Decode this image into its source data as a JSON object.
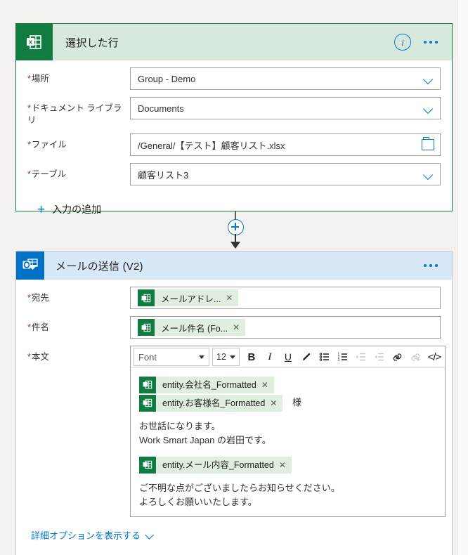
{
  "page": {
    "background": "#f3f2f1",
    "accent": "#0078d4"
  },
  "excel_card": {
    "title": "選択した行",
    "icon": "excel-icon",
    "accent": "#107c41",
    "header_background": "#d7e9dd",
    "info_label": "i",
    "more_label": "…",
    "fields": [
      {
        "label": "場所",
        "required": "*",
        "value": "Group - Demo",
        "control": "dropdown"
      },
      {
        "label": "ドキュメント ライブラリ",
        "required": "*",
        "value": "Documents",
        "control": "dropdown"
      },
      {
        "label": "ファイル",
        "required": "*",
        "value": "/General/【テスト】顧客リスト.xlsx",
        "control": "folder"
      },
      {
        "label": "テーブル",
        "required": "*",
        "value": "顧客リスト3",
        "control": "dropdown"
      }
    ],
    "add_input_label": "入力の追加",
    "add_input_icon": "plus-icon"
  },
  "connector": {
    "add_step_icon": "plus-circle-icon",
    "arrow_icon": "arrow-down-icon"
  },
  "outlook_card": {
    "title": "メールの送信 (V2)",
    "icon": "outlook-icon",
    "accent": "#0072c6",
    "header_background": "#d9e8f6",
    "more_label": "…",
    "to": {
      "label": "宛先",
      "required": "*",
      "token": "メールアドレ...",
      "remove": "✕"
    },
    "subject": {
      "label": "件名",
      "required": "*",
      "token": "メール件名 (Fo...",
      "remove": "✕"
    },
    "body": {
      "label": "本文",
      "required": "*",
      "toolbar": {
        "font_name": "Font",
        "font_size": "12",
        "bold": "B",
        "italic": "I",
        "underline": "U",
        "highlight_icon": "pen-icon",
        "bullet_list_icon": "bulleted-list-icon",
        "numbered_list_icon": "numbered-list-icon",
        "indent_icon": "indent-icon",
        "outdent_icon": "outdent-icon",
        "link_icon": "link-icon",
        "unlink_icon": "unlink-icon",
        "code_label": "</>"
      },
      "content": [
        {
          "type": "token",
          "text": "entity.会社名_Formatted",
          "remove": "✕"
        },
        {
          "type": "token",
          "text": "entity.お客様名_Formatted",
          "remove": "✕",
          "suffix": "様"
        },
        {
          "type": "text",
          "text": "お世話になります。"
        },
        {
          "type": "text",
          "text": "Work Smart Japan の岩田です。"
        },
        {
          "type": "token",
          "text": "entity.メール内容_Formatted",
          "remove": "✕"
        },
        {
          "type": "text",
          "text": "ご不明な点がございましたらお知らせください。"
        },
        {
          "type": "text",
          "text": "よろしくお願いいたします。"
        }
      ]
    },
    "advanced_options_label": "詳細オプションを表示する",
    "advanced_options_icon": "chevron-down-icon"
  }
}
